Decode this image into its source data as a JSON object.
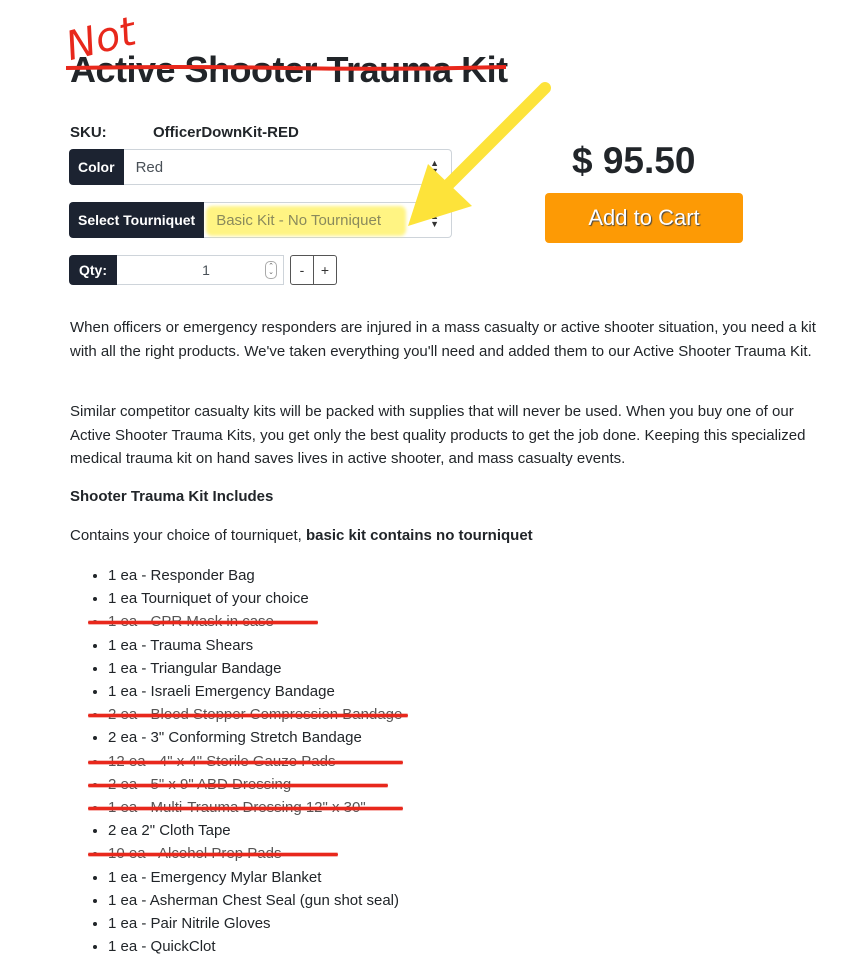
{
  "annotation": {
    "not_text": "Not",
    "annotation_color": "#e8281c",
    "highlight_color": "#fff05a",
    "arrow_color": "#fde33a"
  },
  "product": {
    "title": "Active Shooter Trauma Kit",
    "title_struck": true,
    "sku_label": "SKU:",
    "sku_value": "OfficerDownKit-RED",
    "price": "$ 95.50",
    "add_to_cart_label": "Add to Cart",
    "accent_color": "#fd9a05"
  },
  "options": {
    "color": {
      "label": "Color",
      "value": "Red"
    },
    "tourniquet": {
      "label": "Select Tourniquet",
      "value": "Basic Kit - No Tourniquet"
    },
    "qty": {
      "label": "Qty:",
      "value": "1",
      "minus_label": "-",
      "plus_label": "+"
    }
  },
  "description": {
    "paragraph1": "When officers or emergency responders are injured in a mass casualty or active shooter situation, you need a kit with all the right products. We've taken everything you'll need and added them to our Active Shooter Trauma Kit.",
    "paragraph2": "Similar competitor casualty kits will be packed with supplies that will never be used. When you buy one of our Active Shooter Trauma Kits, you get only the best quality products to get the job done. Keeping this specialized medical trauma kit on hand saves lives in active shooter, and mass casualty events.",
    "includes_heading": "Shooter Trauma Kit Includes",
    "contains_text": "Contains your choice of tourniquet, ",
    "contains_bold": "basic kit contains no tourniquet"
  },
  "kit_items": [
    {
      "text": "1 ea - Responder Bag",
      "struck": false
    },
    {
      "text": "1 ea Tourniquet of your choice",
      "struck": false
    },
    {
      "text": "1 ea - CPR Mask in case",
      "struck": true
    },
    {
      "text": "1 ea - Trauma Shears",
      "struck": false
    },
    {
      "text": "1 ea - Triangular Bandage",
      "struck": false
    },
    {
      "text": "1 ea - Israeli Emergency Bandage",
      "struck": false
    },
    {
      "text": "2 ea - Blood Stopper Compression Bandage",
      "struck": true
    },
    {
      "text": "2 ea - 3\" Conforming Stretch Bandage",
      "struck": false
    },
    {
      "text": "12 ea - 4\" x 4\" Sterile Gauze Pads",
      "struck": true
    },
    {
      "text": "2 ea - 5\" x 9\" ABD Dressing",
      "struck": true
    },
    {
      "text": "1 ea - Multi-Trauma Dressing 12\" x 30\"",
      "struck": true
    },
    {
      "text": "2 ea 2\" Cloth Tape",
      "struck": false
    },
    {
      "text": "10 ea - Alcohol Prep Pads",
      "struck": true
    },
    {
      "text": "1 ea - Emergency Mylar Blanket",
      "struck": false
    },
    {
      "text": "1 ea - Asherman Chest Seal (gun shot seal)",
      "struck": false
    },
    {
      "text": "1 ea - Pair Nitrile Gloves",
      "struck": false
    },
    {
      "text": "1 ea - QuickClot",
      "struck": false
    }
  ]
}
